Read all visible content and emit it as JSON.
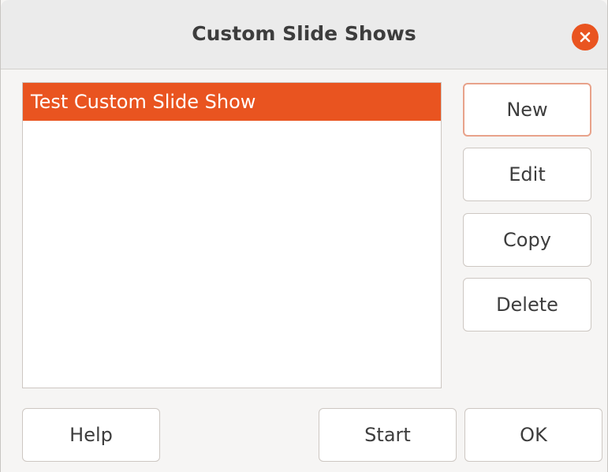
{
  "dialog": {
    "title": "Custom Slide Shows",
    "close_icon": "close-icon",
    "accent_color": "#e95420"
  },
  "list": {
    "items": [
      {
        "label": "Test Custom Slide Show",
        "selected": true
      }
    ]
  },
  "side_buttons": {
    "new": "New",
    "edit": "Edit",
    "copy": "Copy",
    "delete": "Delete"
  },
  "bottom_buttons": {
    "help": "Help",
    "start": "Start",
    "ok": "OK"
  }
}
